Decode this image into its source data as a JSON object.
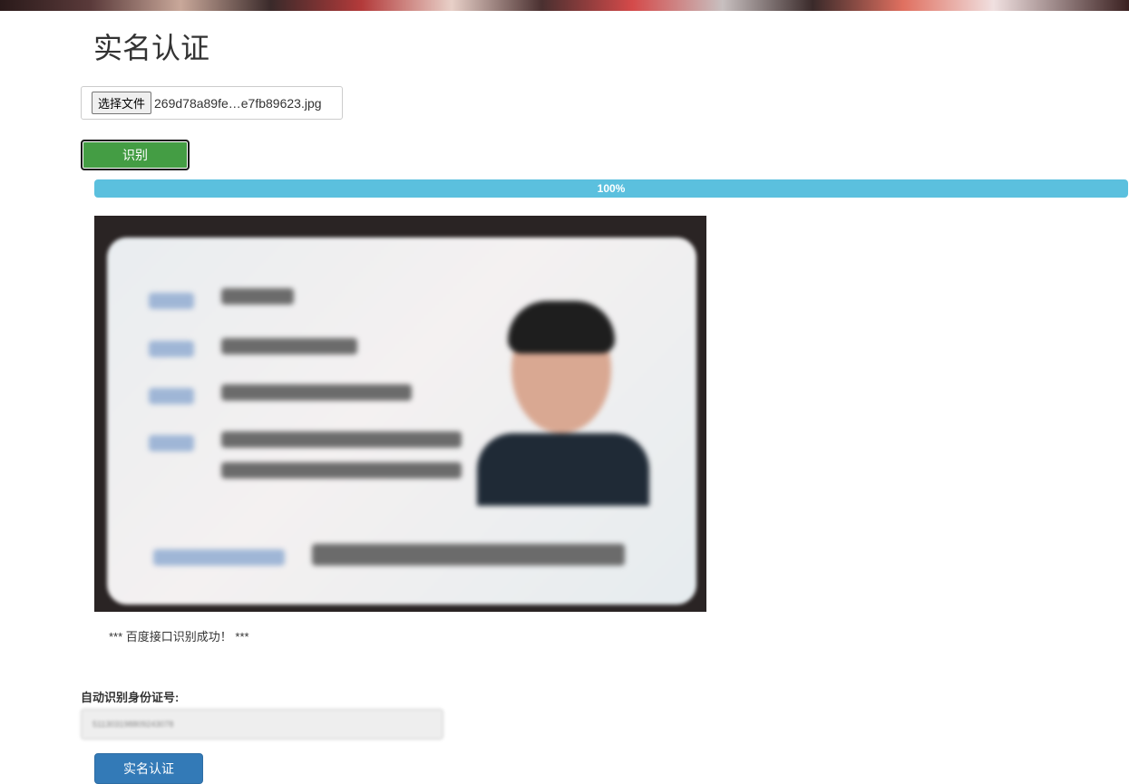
{
  "page": {
    "title": "实名认证"
  },
  "upload": {
    "choose_label": "选择文件",
    "file_name": "269d78a89fe…e7fb89623.jpg"
  },
  "recognize": {
    "button_label": "识别"
  },
  "progress": {
    "value": 1.0,
    "label": "100%"
  },
  "id_photo": {
    "description_icon": "id-card-image"
  },
  "result": {
    "message": "*** 百度接口识别成功！ ***"
  },
  "id_field": {
    "label": "自动识别身份证号:",
    "value": "511303198809243078"
  },
  "verify": {
    "button_label": "实名认证"
  },
  "colors": {
    "recognize_bg": "#449d44",
    "progress_bar": "#5bc0de",
    "verify_bg": "#337ab7"
  }
}
